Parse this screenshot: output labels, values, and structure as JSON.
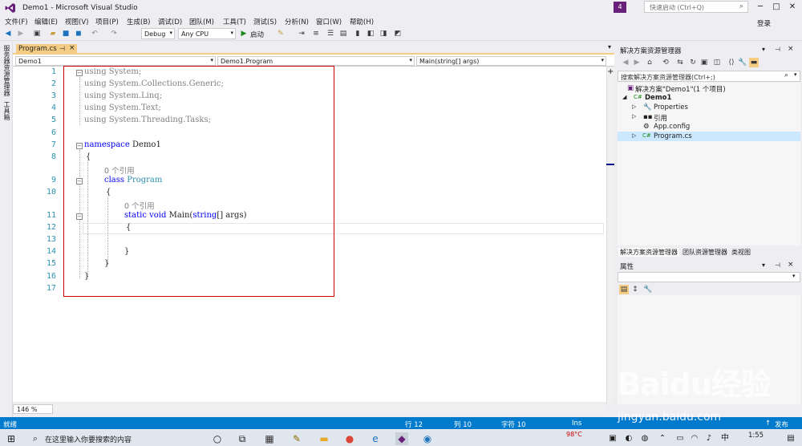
{
  "window": {
    "title": "Demo1 - Microsoft Visual Studio",
    "notifications": "4",
    "quick_launch_placeholder": "快速启动 (Ctrl+Q)",
    "login": "登录"
  },
  "menu": [
    "文件(F)",
    "编辑(E)",
    "视图(V)",
    "项目(P)",
    "生成(B)",
    "调试(D)",
    "团队(M)",
    "工具(T)",
    "测试(S)",
    "分析(N)",
    "窗口(W)",
    "帮助(H)"
  ],
  "toolbar": {
    "config": "Debug",
    "platform": "Any CPU",
    "start_label": "启动"
  },
  "left_strip": {
    "tab1": "服务器资源管理器",
    "tab2": "工具箱"
  },
  "editor": {
    "tab_label": "Program.cs",
    "nav": {
      "project": "Demo1",
      "class": "Demo1.Program",
      "member": "Main(string[] args)"
    },
    "line_numbers": [
      "1",
      "2",
      "3",
      "4",
      "5",
      "6",
      "7",
      "8",
      "9",
      "10",
      "11",
      "12",
      "13",
      "14",
      "15",
      "16",
      "17"
    ],
    "lines": {
      "l1": "using System;",
      "l2": "using System.Collections.Generic;",
      "l3": "using System.Linq;",
      "l4": "using System.Text;",
      "l5": "using System.Threading.Tasks;",
      "l7_kw": "namespace",
      "l7_name": "Demo1",
      "l8": "{",
      "ref1": "0 个引用",
      "l9_kw": "class",
      "l9_name": "Program",
      "l10": "{",
      "ref2": "0 个引用",
      "l11_kw1": "static",
      "l11_kw2": "void",
      "l11_name": "Main(",
      "l11_kw3": "string",
      "l11_rest": "[] args)",
      "l12": "{",
      "l14": "}",
      "l15": "}",
      "l16": "}"
    },
    "zoom": "146 %"
  },
  "solution_explorer": {
    "title": "解决方案资源管理器",
    "search_placeholder": "搜索解决方案资源管理器(Ctrl+;)",
    "items": [
      "解决方案\"Demo1\"(1 个项目)",
      "Demo1",
      "Properties",
      "引用",
      "App.config",
      "Program.cs"
    ],
    "tabs": [
      "解决方案资源管理器",
      "团队资源管理器",
      "类视图"
    ]
  },
  "properties": {
    "title": "属性"
  },
  "status": {
    "ready": "就绪",
    "row": "行 12",
    "col": "列 10",
    "char": "字符 10",
    "ins": "Ins",
    "publish": "发布"
  },
  "taskbar": {
    "search_placeholder": "在这里输入你要搜索的内容",
    "time": "1:55",
    "temp": "98°C"
  },
  "watermark": {
    "logo": "Baidu经验",
    "url": "jingyan.baidu.com"
  }
}
